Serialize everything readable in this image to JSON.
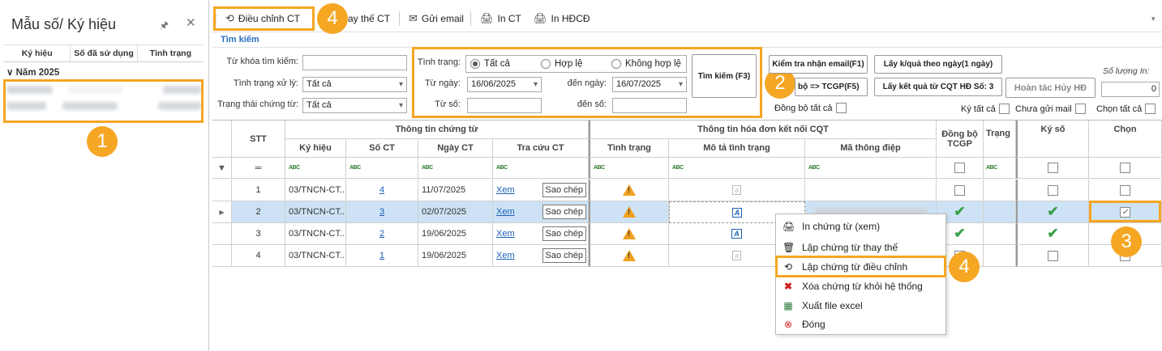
{
  "left_panel": {
    "title": "Mẫu số/ Ký hiệu",
    "columns": [
      "Ký hiệu",
      "Số đã sử dụng",
      "Tình trạng"
    ],
    "group": "Năm 2025"
  },
  "toolbar": {
    "adjust": "Điều chỉnh CT",
    "replace": "ay thế CT",
    "email": "Gửi email",
    "print_ct": "In CT",
    "print_hdcd": "In HĐCĐ"
  },
  "search": {
    "title": "Tìm kiếm",
    "keyword_label": "Từ khóa tìm kiếm:",
    "process_label": "Tình trạng xử lý:",
    "process_value": "Tất cả",
    "doc_status_label": "Trạng thái chứng từ:",
    "doc_status_value": "Tất cả",
    "status_label": "Tình trạng:",
    "radio_all": "Tất cả",
    "radio_valid": "Hợp lệ",
    "radio_invalid": "Không hợp lệ",
    "from_date_label": "Từ ngày:",
    "from_date": "16/06/2025",
    "to_date_label": "đến ngày:",
    "to_date": "16/07/2025",
    "from_no_label": "Từ số:",
    "to_no_label": "đến số:",
    "search_btn": "Tìm kiếm (F3)",
    "check_email_btn": "Kiểm tra nhận email(F1)",
    "get_result_btn": "Lấy k/quả theo ngày(1 ngày)",
    "sync_btn": "bộ => TCGP(F5)",
    "get_cqt_btn": "Lấy kết quả từ CQT HĐ Số: 3",
    "undo_cancel_btn": "Hoàn tác Hủy HĐ",
    "print_qty_label": "Số lượng In:",
    "print_qty": "0",
    "sync_all_label": "Đồng bộ tất cả",
    "sign_all_label": "Ký tất cả",
    "unsent_mail_label": "Chưa gửi mail",
    "select_all_label": "Chọn tất cả"
  },
  "grid": {
    "group_doc": "Thông tin chứng từ",
    "group_invoice": "Thông tin hóa đơn kết nối CQT",
    "col_stt": "STT",
    "col_kyhieu": "Ký hiệu",
    "col_soct": "Số CT",
    "col_ngayct": "Ngày CT",
    "col_tracuu": "Tra cứu CT",
    "col_tinhtrang": "Tình trạng",
    "col_mota": "Mô tả tình trạng",
    "col_mathongdiep": "Mã thông điệp",
    "col_dongbo": "Đồng bộ TCGP",
    "col_trang": "Trạng",
    "col_kyso": "Ký số",
    "col_chon": "Chọn",
    "filter_eq": "═",
    "rows": [
      {
        "stt": "1",
        "kyhieu": "03/TNCN-CT...",
        "soct": "4",
        "ngay": "11/07/2025",
        "xem": "Xem",
        "copy": "Sao chép"
      },
      {
        "stt": "2",
        "kyhieu": "03/TNCN-CT...",
        "soct": "3",
        "ngay": "02/07/2025",
        "xem": "Xem",
        "copy": "Sao chép"
      },
      {
        "stt": "3",
        "kyhieu": "03/TNCN-CT...",
        "soct": "2",
        "ngay": "19/06/2025",
        "xem": "Xem",
        "copy": "Sao chép"
      },
      {
        "stt": "4",
        "kyhieu": "03/TNCN-CT...",
        "soct": "1",
        "ngay": "19/06/2025",
        "xem": "Xem",
        "copy": "Sao chép"
      }
    ]
  },
  "context_menu": {
    "items": [
      "In chứng từ (xem)",
      "Lập chứng từ thay thế",
      "Lập chứng từ điều chỉnh",
      "Xóa chứng từ khỏi hệ thống",
      "Xuất file excel",
      "Đóng"
    ]
  },
  "badges": {
    "b1": "1",
    "b2": "2",
    "b3": "3",
    "b4": "4"
  },
  "colors": {
    "highlight": "#f5a623",
    "link": "#1a5fb4",
    "selected_row": "#cde3f5"
  }
}
